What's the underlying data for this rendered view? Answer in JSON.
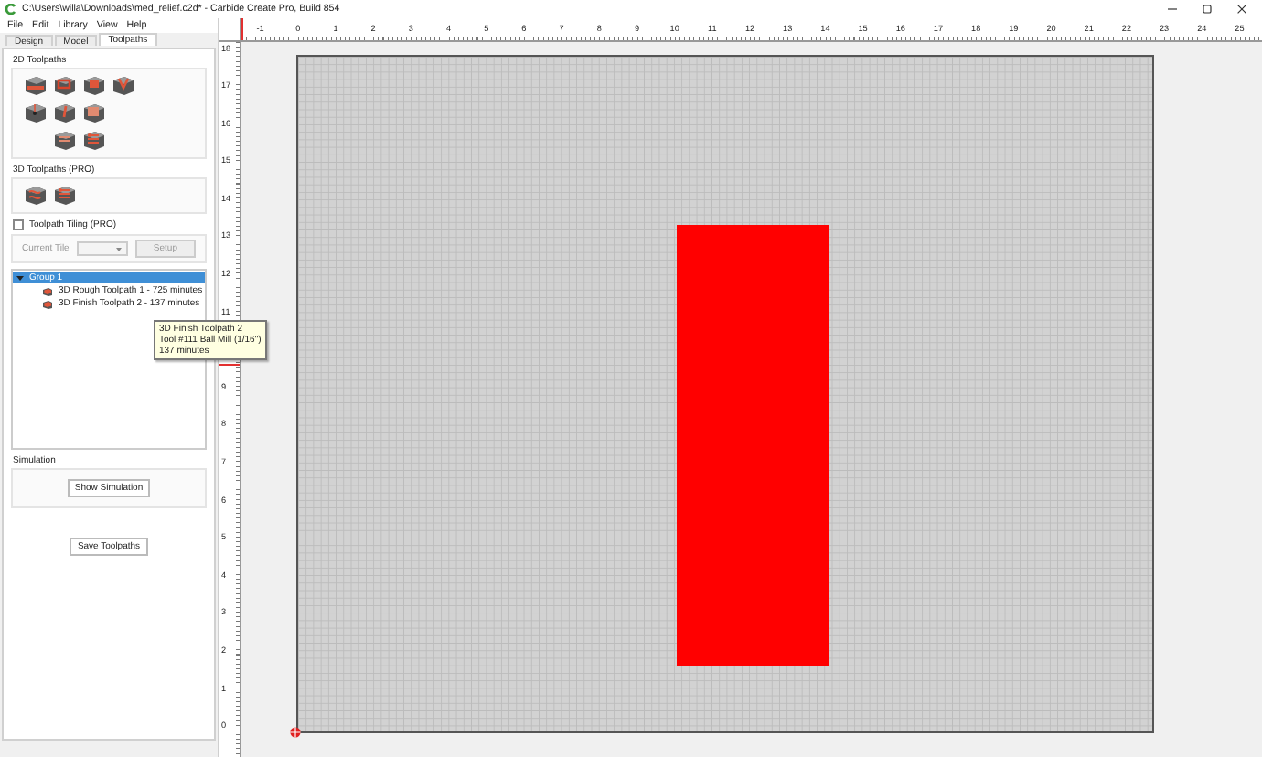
{
  "window": {
    "title": "C:\\Users\\willa\\Downloads\\med_relief.c2d* - Carbide Create Pro, Build 854"
  },
  "menu": [
    "File",
    "Edit",
    "Library",
    "View",
    "Help"
  ],
  "tabs": [
    {
      "label": "Design",
      "selected": false
    },
    {
      "label": "Model",
      "selected": false
    },
    {
      "label": "Toolpaths",
      "selected": true
    }
  ],
  "toolpaths_2d": {
    "heading": "2D Toolpaths"
  },
  "toolpaths_3d": {
    "heading": "3D Toolpaths (PRO)"
  },
  "tiling": {
    "label": "Toolpath Tiling (PRO)",
    "checked": false,
    "current_tile_label": "Current Tile",
    "setup_button": "Setup",
    "disabled": true
  },
  "tree": [
    {
      "label": "Group 1",
      "selected": true,
      "expanded": true,
      "children": [
        {
          "label": "3D Rough Toolpath 1 - 725 minutes",
          "selected": false
        },
        {
          "label": "3D Finish Toolpath 2 - 137 minutes",
          "selected": false
        }
      ]
    }
  ],
  "tooltip": {
    "lines": [
      "3D Finish Toolpath 2",
      "Tool #111 Ball Mill (1/16\")",
      "137 minutes"
    ]
  },
  "simulation": {
    "heading": "Simulation",
    "button": "Show Simulation"
  },
  "save_button": "Save Toolpaths",
  "ruler": {
    "x_labels": [
      "-1",
      "0",
      "1",
      "2",
      "3",
      "4",
      "5",
      "6",
      "7",
      "8",
      "9",
      "10",
      "11",
      "12",
      "13",
      "14",
      "15",
      "16",
      "17",
      "18",
      "19",
      "20",
      "21",
      "22",
      "23",
      "24",
      "25"
    ],
    "y_labels_above_tooltip": [
      "18",
      "17",
      "16",
      "15",
      "14",
      "13",
      "12",
      "11"
    ],
    "y_labels_below_tooltip": [
      "9",
      "8",
      "7",
      "6",
      "5",
      "4",
      "3",
      "2",
      "1",
      "0"
    ]
  }
}
